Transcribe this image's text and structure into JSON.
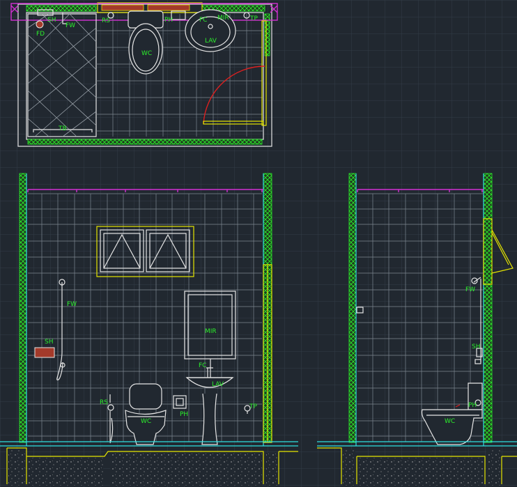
{
  "plan": {
    "labels": {
      "sh": "SH",
      "fw": "FW",
      "fd": "FD",
      "rs": "RS",
      "ph": "PH",
      "fc": "FC",
      "mir": "MIR",
      "tp": "TP",
      "wc": "WC",
      "lav": "LAV",
      "tb": "TB"
    }
  },
  "front_elevation": {
    "labels": {
      "fw": "FW",
      "sh": "SH",
      "mir": "MIR",
      "fc": "FC",
      "lav": "LAV",
      "rs": "RS",
      "wc": "WC",
      "ph": "PH",
      "tp": "TP"
    }
  },
  "side_elevation": {
    "labels": {
      "fw": "FW",
      "sh": "SH",
      "ph": "PH",
      "wc": "WC"
    }
  },
  "colors": {
    "background": "#212830",
    "grid": "#3a4652",
    "text": "#2cf02c",
    "fixture_lines": "#e6e6e6",
    "frame": "#e6e600",
    "wall_edge": "#2fe0e0",
    "ceiling": "#d330d3",
    "door_swing": "#dd2020"
  }
}
